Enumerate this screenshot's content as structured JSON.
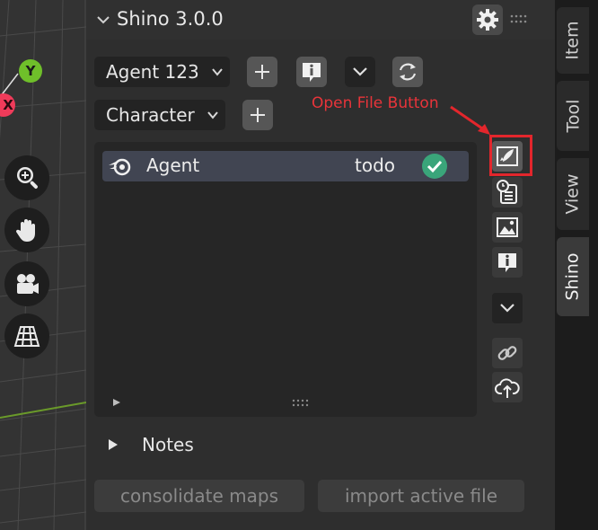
{
  "viewport": {
    "axis_y_label": "Y",
    "axis_x_label": "X",
    "tools": [
      {
        "icon": "zoom-icon"
      },
      {
        "icon": "hand-pan-icon"
      },
      {
        "icon": "camera-icon"
      },
      {
        "icon": "perspective-grid-icon"
      }
    ]
  },
  "panel": {
    "title": "Shino 3.0.0",
    "agent_dropdown": "Agent 123",
    "character_dropdown": "Character",
    "list_items": [
      {
        "name": "Agent",
        "status": "todo",
        "icon": "blender-icon",
        "status_icon": "check-circle-icon"
      }
    ],
    "side_tools": [
      "rocket-file-icon",
      "clock-notes-icon",
      "image-icon",
      "info-icon",
      "chevron-down-icon",
      "link-icon",
      "cloud-upload-icon"
    ],
    "notes_label": "Notes",
    "consolidate_button": "consolidate maps",
    "import_button": "import active file"
  },
  "tabs": [
    "Item",
    "Tool",
    "View",
    "Shino"
  ],
  "active_tab": "Shino",
  "annotation": {
    "label": "Open File Button",
    "color": "#e3262c"
  },
  "colors": {
    "panel_bg": "#2e2e2e",
    "list_highlight": "#414552",
    "check_green": "#3aa57a",
    "axis_y": "#6fbf2a",
    "axis_x": "#ef3b5a"
  }
}
